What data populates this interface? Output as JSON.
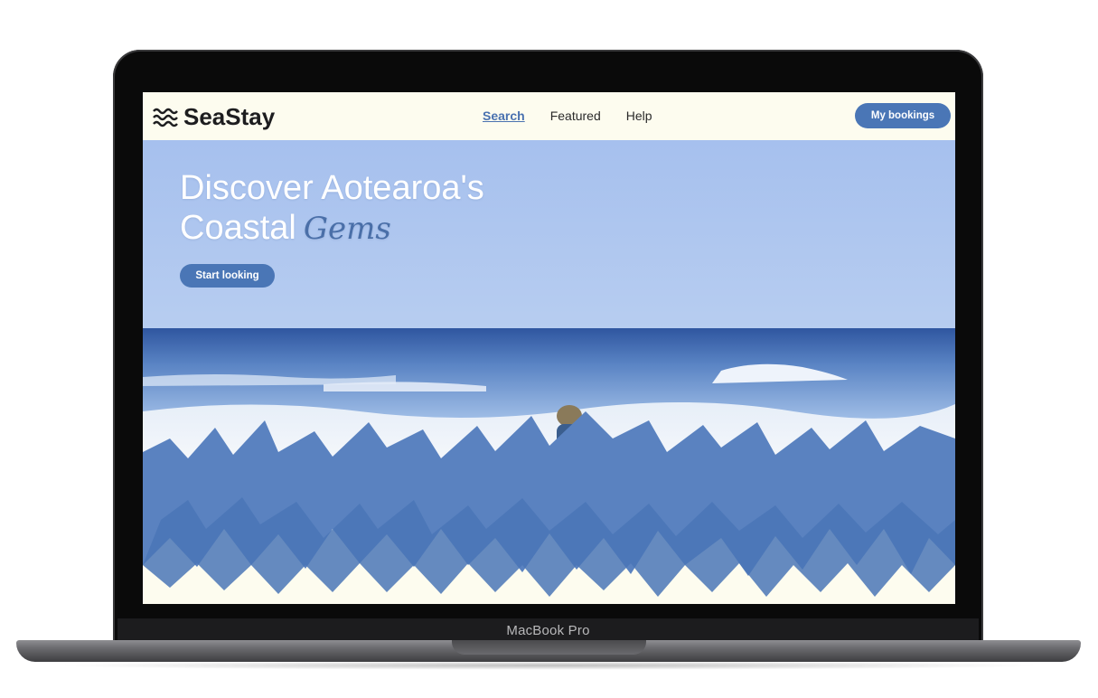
{
  "device": {
    "label": "MacBook Pro"
  },
  "site": {
    "brand": "SeaStay",
    "logo_icon": "waves-icon",
    "colors": {
      "accent": "#4a76b6",
      "background": "#fdfcef",
      "script": "#4a6fa8"
    }
  },
  "nav": {
    "links": [
      {
        "label": "Search",
        "active": true
      },
      {
        "label": "Featured",
        "active": false
      },
      {
        "label": "Help",
        "active": false
      }
    ],
    "bookings_label": "My bookings"
  },
  "hero": {
    "line1": "Discover Aotearoa's",
    "line2": "Coastal",
    "script_word": "Gems",
    "cta_label": "Start looking"
  }
}
